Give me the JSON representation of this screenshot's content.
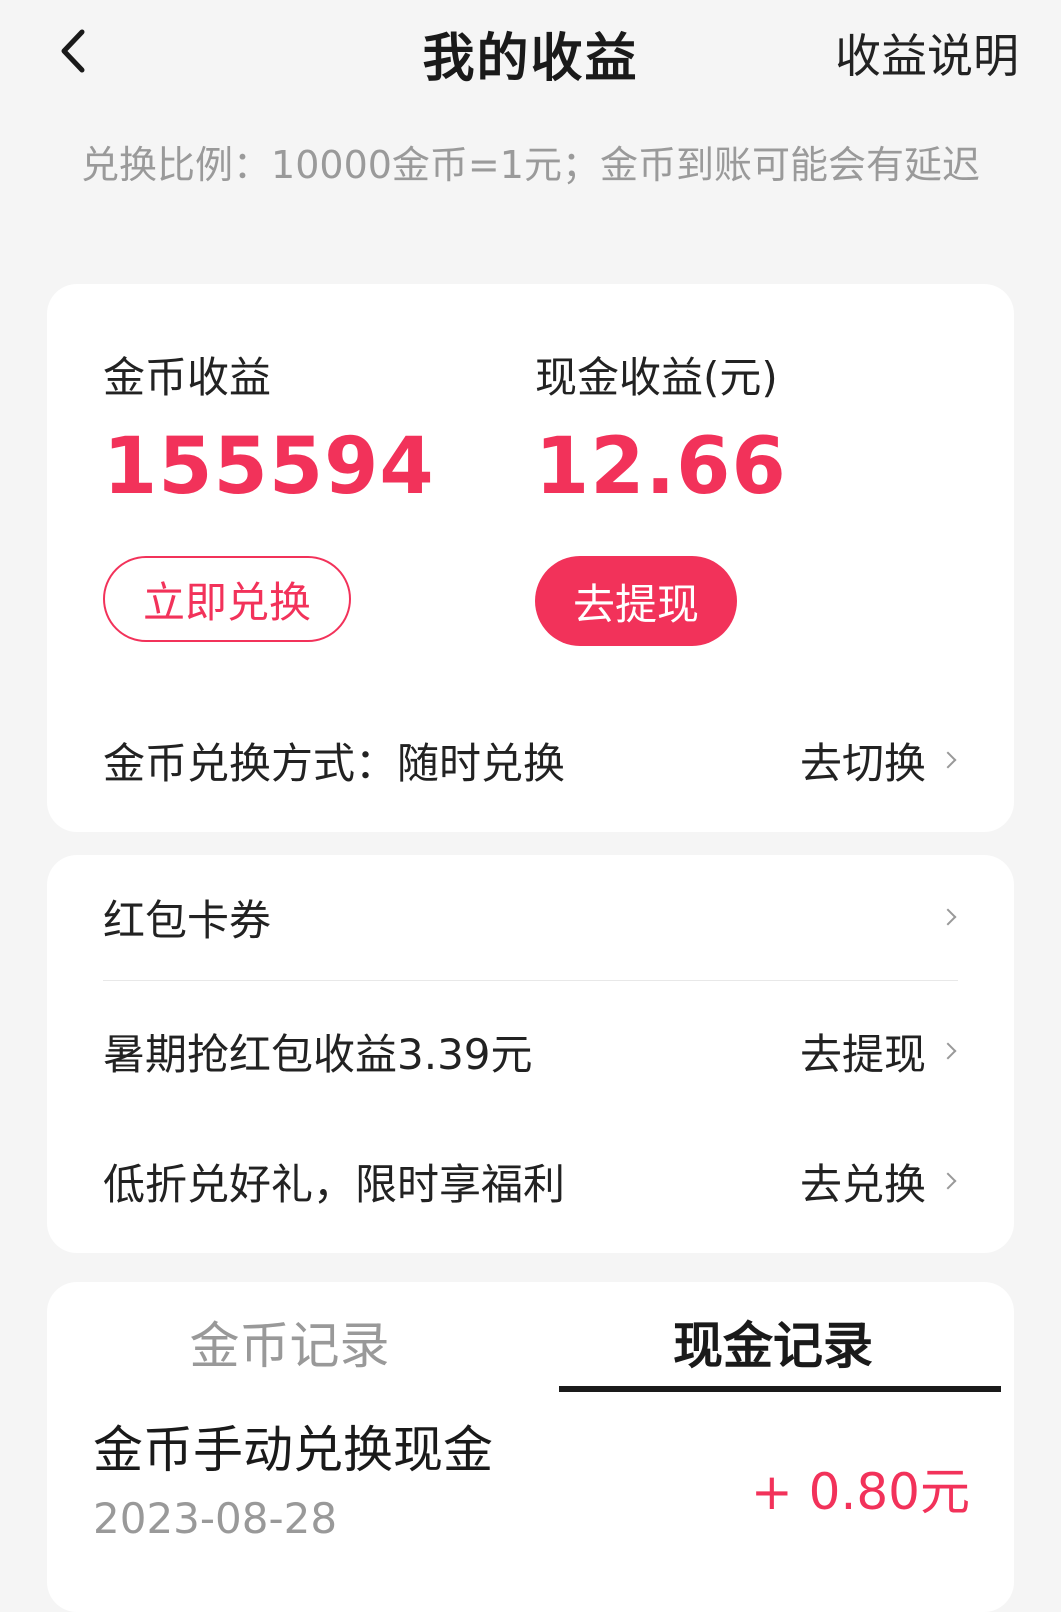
{
  "header": {
    "title": "我的收益",
    "right_link": "收益说明"
  },
  "notice": "兑换比例：10000金币=1元；金币到账可能会有延迟",
  "earnings": {
    "coin_label": "金币收益",
    "coin_value": "155594",
    "cash_label": "现金收益(元)",
    "cash_value": "12.66",
    "exchange_button": "立即兑换",
    "withdraw_button": "去提现",
    "method_label": "金币兑换方式：",
    "method_value": "随时兑换",
    "method_action": "去切换"
  },
  "list": [
    {
      "label": "红包卡券",
      "action": ""
    },
    {
      "label": "暑期抢红包收益3.39元",
      "action": "去提现"
    },
    {
      "label": "低折兑好礼，限时享福利",
      "action": "去兑换"
    }
  ],
  "records": {
    "tabs": [
      {
        "label": "金币记录",
        "active": false
      },
      {
        "label": "现金记录",
        "active": true
      }
    ],
    "items": [
      {
        "title": "金币手动兑换现金",
        "date": "2023-08-28",
        "amount": "+ 0.80元"
      }
    ]
  },
  "colors": {
    "accent": "#f2325a",
    "background": "#f5f5f5"
  },
  "icons": {
    "back": "chevron-left-icon",
    "row_arrow": "chevron-right-icon"
  }
}
